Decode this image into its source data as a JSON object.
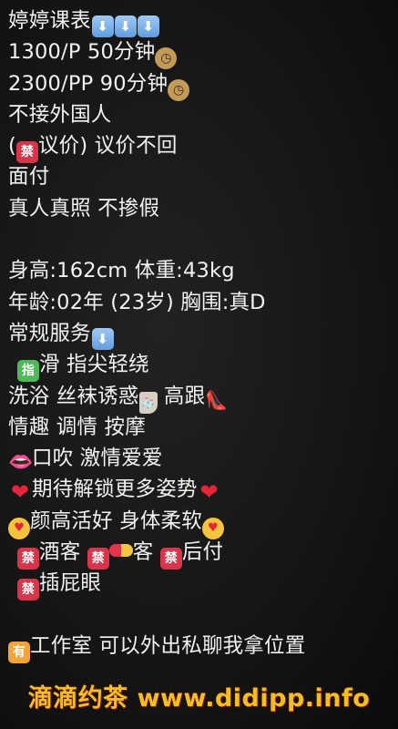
{
  "lines": [
    {
      "text": "婷婷课表",
      "icons": [
        "arrow-down",
        "arrow-down",
        "arrow-down"
      ]
    },
    {
      "text": "1300/P 50分钟",
      "icons": [
        "clock"
      ]
    },
    {
      "text": "2300/PP 90分钟",
      "icons": [
        "clock"
      ]
    },
    {
      "text": "不接外国人"
    },
    {
      "pre": "(",
      "text": "议价) 议价不回"
    },
    {
      "text": "面付"
    },
    {
      "text": "真人真照 不掺假"
    },
    {
      "text": "身高:162cm 体重:43kg"
    },
    {
      "text": "年龄:02年 (23岁) 胸围:真D"
    },
    {
      "text": "常规服务"
    },
    {
      "text": "滑 指尖轻绕"
    },
    {
      "a": "洗浴 丝袜诱惑",
      "b": " 高跟"
    },
    {
      "text": "情趣  调情 按摩"
    },
    {
      "text": "口吹 激情爱爱"
    },
    {
      "text": "期待解锁更多姿势"
    },
    {
      "text": "颜高活好 身体柔软"
    },
    {
      "a": "酒客 ",
      "b": "客 ",
      "c": "后付"
    },
    {
      "text": "插屁眼"
    },
    {
      "text": "工作室 可以外出私聊我拿位置"
    }
  ],
  "emoji_glyphs": {
    "forbid": "禁",
    "finger": "指",
    "have": "有",
    "arrow": "⬇",
    "clock": "◷",
    "heart": "❤",
    "face": "♥",
    "lips": "👄",
    "heel": "👠",
    "sock": "🧦"
  },
  "watermark": "滴滴约茶 www.didipp.info"
}
